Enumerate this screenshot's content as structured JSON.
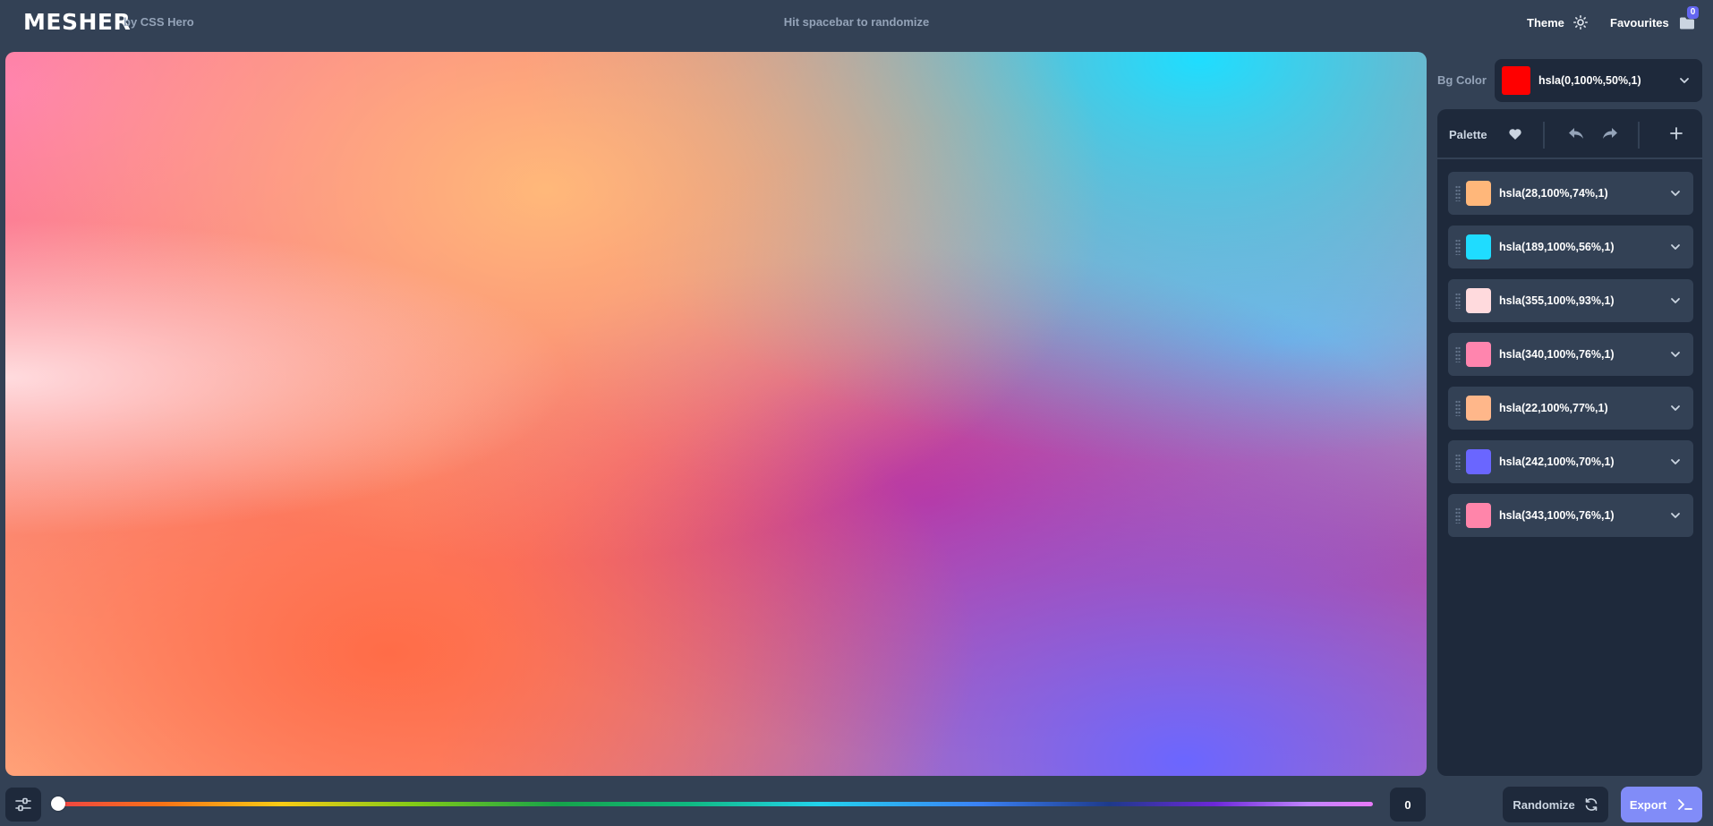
{
  "header": {
    "logo": "MESHER",
    "byline": "by CSS Hero",
    "hint": "Hit spacebar to randomize",
    "theme_label": "Theme",
    "theme_icon": "sun-icon",
    "favourites_label": "Favourites",
    "favourites_icon": "folder-icon",
    "favourites_count": "0"
  },
  "bg_color": {
    "label": "Bg Color",
    "value": "hsla(0,100%,50%,1)",
    "swatch": "#ff0000"
  },
  "palette": {
    "label": "Palette",
    "icons": [
      "heart-icon",
      "undo-icon",
      "redo-icon",
      "plus-icon"
    ],
    "colors": [
      {
        "value": "hsla(28,100%,74%,1)",
        "swatch": "#ffb77a"
      },
      {
        "value": "hsla(189,100%,56%,1)",
        "swatch": "#1fdcff"
      },
      {
        "value": "hsla(355,100%,93%,1)",
        "swatch": "#ffdadd"
      },
      {
        "value": "hsla(340,100%,76%,1)",
        "swatch": "#ff85ae"
      },
      {
        "value": "hsla(22,100%,77%,1)",
        "swatch": "#ffb78a"
      },
      {
        "value": "hsla(242,100%,70%,1)",
        "swatch": "#6a66ff"
      },
      {
        "value": "hsla(343,100%,76%,1)",
        "swatch": "#ff85aa"
      }
    ]
  },
  "footer": {
    "settings_icon": "sliders-icon",
    "slider_value": "0",
    "randomize_label": "Randomize",
    "randomize_icon": "refresh-icon",
    "export_label": "Export",
    "export_icon": "terminal-icon"
  }
}
